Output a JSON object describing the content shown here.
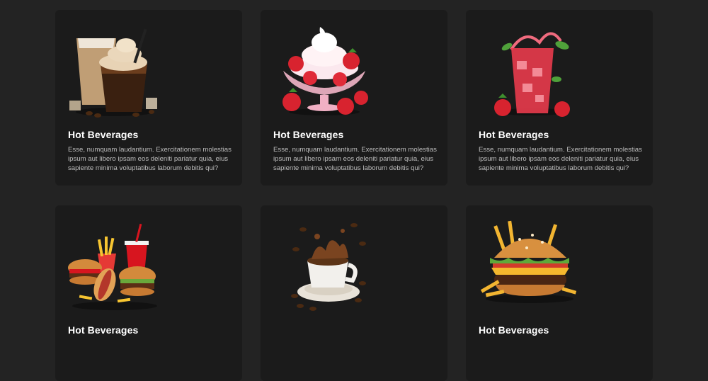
{
  "cards": [
    {
      "title": "Hot Beverages",
      "description": "Esse, numquam laudantium. Exercitationem molestias ipsum aut libero ipsam eos deleniti pariatur quia, eius sapiente minima voluptatibus laborum debitis qui?",
      "image": "iced-coffee-drinks-image"
    },
    {
      "title": "Hot Beverages",
      "description": "Esse, numquam laudantium. Exercitationem molestias ipsum aut libero ipsam eos deleniti pariatur quia, eius sapiente minima voluptatibus laborum debitis qui?",
      "image": "strawberry-sundae-image"
    },
    {
      "title": "Hot Beverages",
      "description": "Esse, numquam laudantium. Exercitationem molestias ipsum aut libero ipsam eos deleniti pariatur quia, eius sapiente minima voluptatibus laborum debitis qui?",
      "image": "strawberry-drink-image"
    },
    {
      "title": "Hot Beverages",
      "description": "",
      "image": "fast-food-combo-image"
    },
    {
      "title": "",
      "description": "",
      "image": "coffee-cup-splash-image"
    },
    {
      "title": "Hot Beverages",
      "description": "",
      "image": "burger-fries-image"
    }
  ],
  "colors": {
    "page_background": "#232323",
    "card_background": "#1b1b1b",
    "title_text": "#ffffff",
    "body_text": "#bdbdbd"
  }
}
